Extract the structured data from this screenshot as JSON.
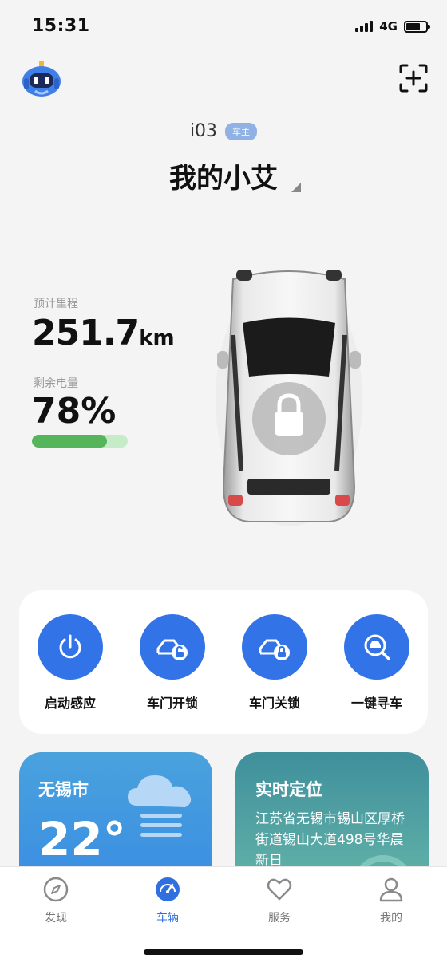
{
  "status_bar": {
    "time": "15:31",
    "network": "4G",
    "battery_level": 0.7
  },
  "header": {
    "avatar_icon": "robot-icon",
    "scan_icon": "scan-add-icon"
  },
  "vehicle": {
    "model": "i03",
    "owner_badge": "车主",
    "name": "我的小艾"
  },
  "stats": {
    "range_label": "预计里程",
    "range_value": "251.7",
    "range_unit": "km",
    "battery_label": "剩余电量",
    "battery_value": "78%",
    "battery_fraction": 0.78
  },
  "quick_actions": [
    {
      "label": "启动感应",
      "icon": "power-icon"
    },
    {
      "label": "车门开锁",
      "icon": "car-unlock-icon"
    },
    {
      "label": "车门关锁",
      "icon": "car-lock-icon"
    },
    {
      "label": "一键寻车",
      "icon": "find-car-icon"
    }
  ],
  "weather": {
    "city": "无锡市",
    "temperature": "22°",
    "icon": "cloud-icon"
  },
  "location": {
    "title": "实时定位",
    "address": "江苏省无锡市锡山区厚桥街道锡山大道498号华晨新日"
  },
  "tabs": [
    {
      "label": "发现",
      "icon": "compass-icon",
      "active": false
    },
    {
      "label": "车辆",
      "icon": "dashboard-icon",
      "active": true
    },
    {
      "label": "服务",
      "icon": "heart-icon",
      "active": false
    },
    {
      "label": "我的",
      "icon": "person-icon",
      "active": false
    }
  ],
  "colors": {
    "accent": "#3274e7",
    "battery_bar": "#55b55a",
    "tab_active": "#2f6fe0"
  }
}
